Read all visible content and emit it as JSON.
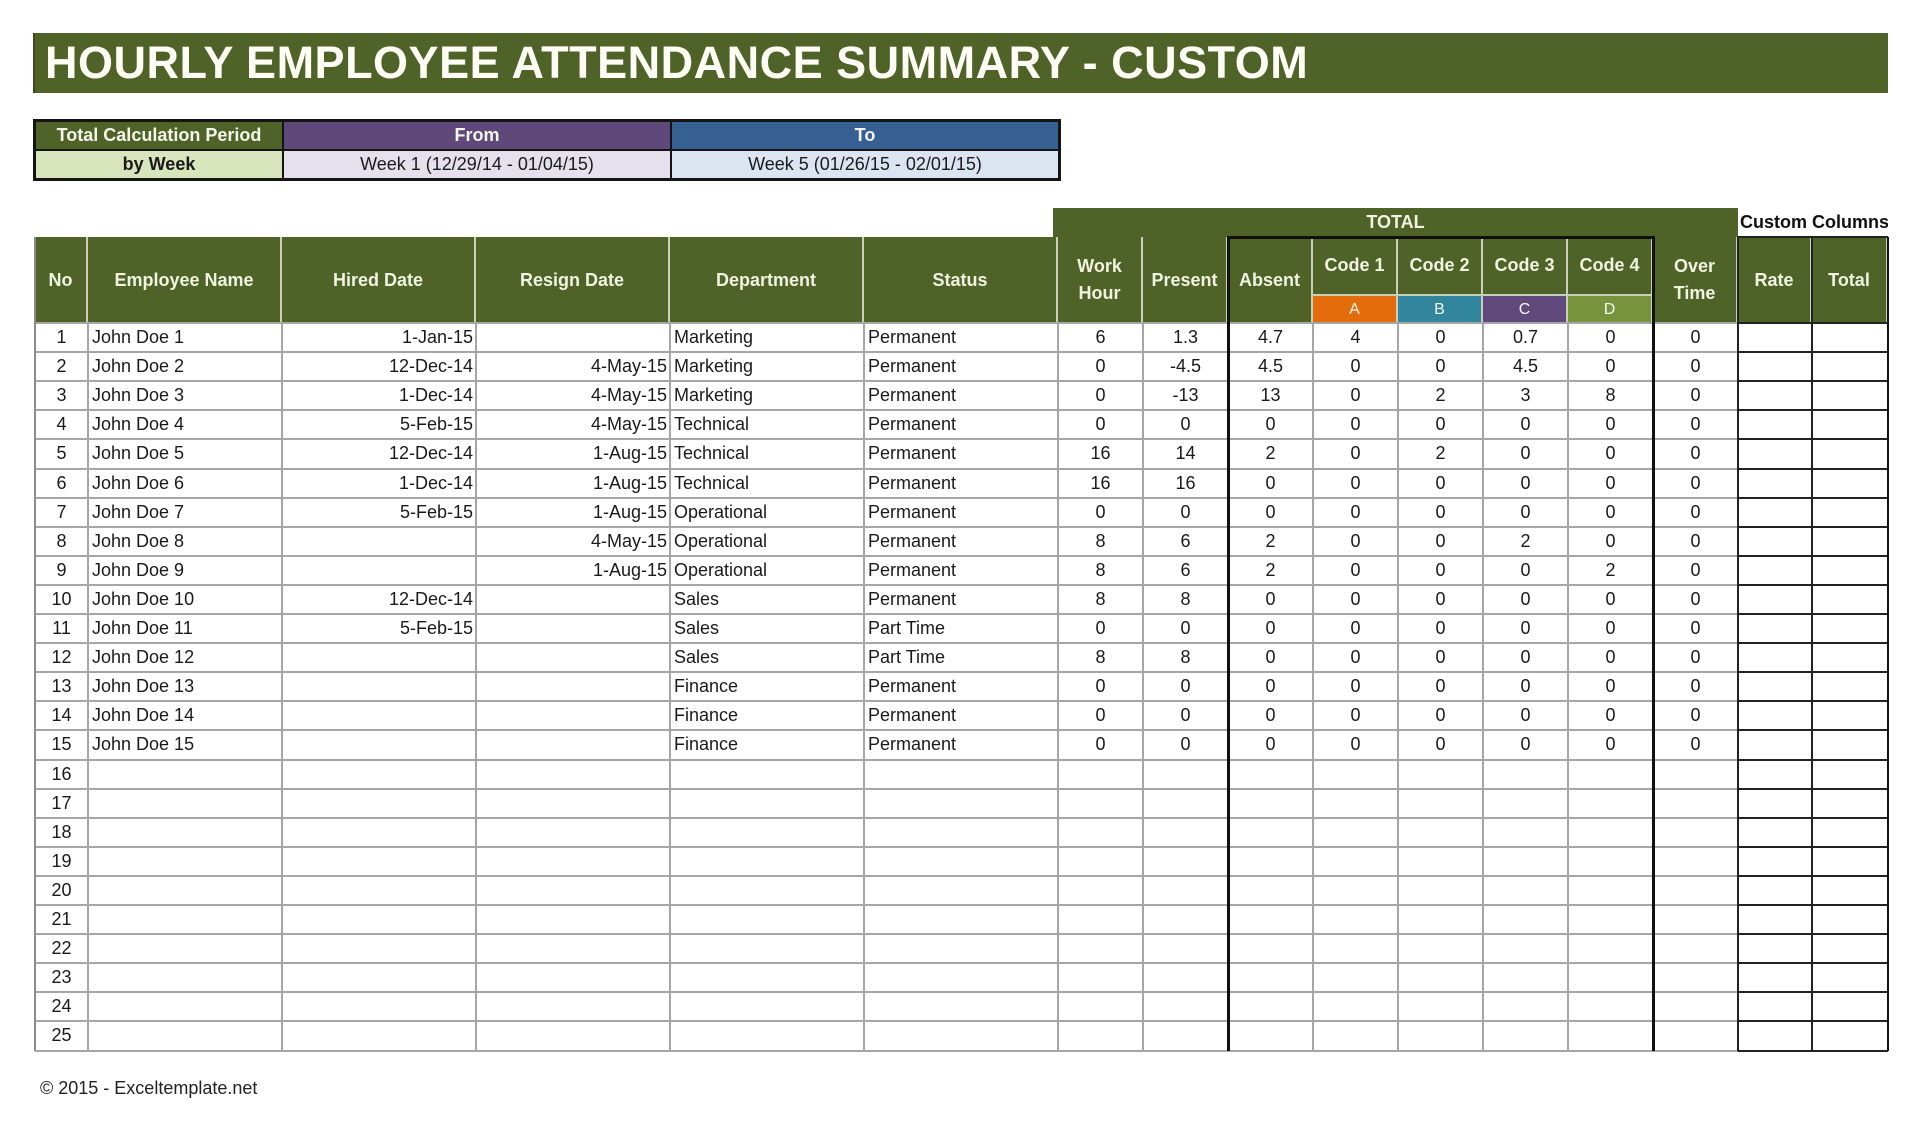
{
  "title": "HOURLY EMPLOYEE ATTENDANCE SUMMARY - CUSTOM",
  "period": {
    "label_header": "Total Calculation Period",
    "label_value": "by Week",
    "from_header": "From",
    "from_value": "Week 1 (12/29/14 - 01/04/15)",
    "to_header": "To",
    "to_value": "Week 5 (01/26/15 - 02/01/15)"
  },
  "colors": {
    "header_green": "#4F6228",
    "from_purple": "#5F497A",
    "to_blue": "#366092",
    "label_light_green": "#D7E4BC",
    "from_light": "#E5E0EC",
    "to_light": "#DBE5F1",
    "code_a": "#E46C0A",
    "code_b": "#31859C",
    "code_c": "#604A7B",
    "code_d": "#77933C"
  },
  "table": {
    "group_total_label": "TOTAL",
    "group_custom_label": "Custom Columns",
    "headers": {
      "no": "No",
      "employee_name": "Employee Name",
      "hired_date": "Hired Date",
      "resign_date": "Resign Date",
      "department": "Department",
      "status": "Status",
      "work_hour": "Work Hour",
      "present": "Present",
      "absent": "Absent",
      "code1": "Code 1",
      "code2": "Code 2",
      "code3": "Code 3",
      "code4": "Code 4",
      "over_time": "Over Time",
      "rate": "Rate",
      "total": "Total"
    },
    "code_letters": [
      "A",
      "B",
      "C",
      "D"
    ],
    "rows": [
      {
        "no": "1",
        "name": "John Doe 1",
        "hired": "1-Jan-15",
        "resign": "",
        "dept": "Marketing",
        "status": "Permanent",
        "work": "6",
        "present": "1.3",
        "absent": "4.7",
        "c1": "4",
        "c2": "0",
        "c3": "0.7",
        "c4": "0",
        "ot": "0",
        "rate": "",
        "total": ""
      },
      {
        "no": "2",
        "name": "John Doe 2",
        "hired": "12-Dec-14",
        "resign": "4-May-15",
        "dept": "Marketing",
        "status": "Permanent",
        "work": "0",
        "present": "-4.5",
        "absent": "4.5",
        "c1": "0",
        "c2": "0",
        "c3": "4.5",
        "c4": "0",
        "ot": "0",
        "rate": "",
        "total": ""
      },
      {
        "no": "3",
        "name": "John Doe 3",
        "hired": "1-Dec-14",
        "resign": "4-May-15",
        "dept": "Marketing",
        "status": "Permanent",
        "work": "0",
        "present": "-13",
        "absent": "13",
        "c1": "0",
        "c2": "2",
        "c3": "3",
        "c4": "8",
        "ot": "0",
        "rate": "",
        "total": ""
      },
      {
        "no": "4",
        "name": "John Doe 4",
        "hired": "5-Feb-15",
        "resign": "4-May-15",
        "dept": "Technical",
        "status": "Permanent",
        "work": "0",
        "present": "0",
        "absent": "0",
        "c1": "0",
        "c2": "0",
        "c3": "0",
        "c4": "0",
        "ot": "0",
        "rate": "",
        "total": ""
      },
      {
        "no": "5",
        "name": "John Doe 5",
        "hired": "12-Dec-14",
        "resign": "1-Aug-15",
        "dept": "Technical",
        "status": "Permanent",
        "work": "16",
        "present": "14",
        "absent": "2",
        "c1": "0",
        "c2": "2",
        "c3": "0",
        "c4": "0",
        "ot": "0",
        "rate": "",
        "total": ""
      },
      {
        "no": "6",
        "name": "John Doe 6",
        "hired": "1-Dec-14",
        "resign": "1-Aug-15",
        "dept": "Technical",
        "status": "Permanent",
        "work": "16",
        "present": "16",
        "absent": "0",
        "c1": "0",
        "c2": "0",
        "c3": "0",
        "c4": "0",
        "ot": "0",
        "rate": "",
        "total": ""
      },
      {
        "no": "7",
        "name": "John Doe 7",
        "hired": "5-Feb-15",
        "resign": "1-Aug-15",
        "dept": "Operational",
        "status": "Permanent",
        "work": "0",
        "present": "0",
        "absent": "0",
        "c1": "0",
        "c2": "0",
        "c3": "0",
        "c4": "0",
        "ot": "0",
        "rate": "",
        "total": ""
      },
      {
        "no": "8",
        "name": "John Doe 8",
        "hired": "",
        "resign": "4-May-15",
        "dept": "Operational",
        "status": "Permanent",
        "work": "8",
        "present": "6",
        "absent": "2",
        "c1": "0",
        "c2": "0",
        "c3": "2",
        "c4": "0",
        "ot": "0",
        "rate": "",
        "total": ""
      },
      {
        "no": "9",
        "name": "John Doe 9",
        "hired": "",
        "resign": "1-Aug-15",
        "dept": "Operational",
        "status": "Permanent",
        "work": "8",
        "present": "6",
        "absent": "2",
        "c1": "0",
        "c2": "0",
        "c3": "0",
        "c4": "2",
        "ot": "0",
        "rate": "",
        "total": ""
      },
      {
        "no": "10",
        "name": "John Doe 10",
        "hired": "12-Dec-14",
        "resign": "",
        "dept": "Sales",
        "status": "Permanent",
        "work": "8",
        "present": "8",
        "absent": "0",
        "c1": "0",
        "c2": "0",
        "c3": "0",
        "c4": "0",
        "ot": "0",
        "rate": "",
        "total": ""
      },
      {
        "no": "11",
        "name": "John Doe 11",
        "hired": "5-Feb-15",
        "resign": "",
        "dept": "Sales",
        "status": "Part Time",
        "work": "0",
        "present": "0",
        "absent": "0",
        "c1": "0",
        "c2": "0",
        "c3": "0",
        "c4": "0",
        "ot": "0",
        "rate": "",
        "total": ""
      },
      {
        "no": "12",
        "name": "John Doe 12",
        "hired": "",
        "resign": "",
        "dept": "Sales",
        "status": "Part Time",
        "work": "8",
        "present": "8",
        "absent": "0",
        "c1": "0",
        "c2": "0",
        "c3": "0",
        "c4": "0",
        "ot": "0",
        "rate": "",
        "total": ""
      },
      {
        "no": "13",
        "name": "John Doe 13",
        "hired": "",
        "resign": "",
        "dept": "Finance",
        "status": "Permanent",
        "work": "0",
        "present": "0",
        "absent": "0",
        "c1": "0",
        "c2": "0",
        "c3": "0",
        "c4": "0",
        "ot": "0",
        "rate": "",
        "total": ""
      },
      {
        "no": "14",
        "name": "John Doe 14",
        "hired": "",
        "resign": "",
        "dept": "Finance",
        "status": "Permanent",
        "work": "0",
        "present": "0",
        "absent": "0",
        "c1": "0",
        "c2": "0",
        "c3": "0",
        "c4": "0",
        "ot": "0",
        "rate": "",
        "total": ""
      },
      {
        "no": "15",
        "name": "John Doe 15",
        "hired": "",
        "resign": "",
        "dept": "Finance",
        "status": "Permanent",
        "work": "0",
        "present": "0",
        "absent": "0",
        "c1": "0",
        "c2": "0",
        "c3": "0",
        "c4": "0",
        "ot": "0",
        "rate": "",
        "total": ""
      },
      {
        "no": "16",
        "name": "",
        "hired": "",
        "resign": "",
        "dept": "",
        "status": "",
        "work": "",
        "present": "",
        "absent": "",
        "c1": "",
        "c2": "",
        "c3": "",
        "c4": "",
        "ot": "",
        "rate": "",
        "total": ""
      },
      {
        "no": "17",
        "name": "",
        "hired": "",
        "resign": "",
        "dept": "",
        "status": "",
        "work": "",
        "present": "",
        "absent": "",
        "c1": "",
        "c2": "",
        "c3": "",
        "c4": "",
        "ot": "",
        "rate": "",
        "total": ""
      },
      {
        "no": "18",
        "name": "",
        "hired": "",
        "resign": "",
        "dept": "",
        "status": "",
        "work": "",
        "present": "",
        "absent": "",
        "c1": "",
        "c2": "",
        "c3": "",
        "c4": "",
        "ot": "",
        "rate": "",
        "total": ""
      },
      {
        "no": "19",
        "name": "",
        "hired": "",
        "resign": "",
        "dept": "",
        "status": "",
        "work": "",
        "present": "",
        "absent": "",
        "c1": "",
        "c2": "",
        "c3": "",
        "c4": "",
        "ot": "",
        "rate": "",
        "total": ""
      },
      {
        "no": "20",
        "name": "",
        "hired": "",
        "resign": "",
        "dept": "",
        "status": "",
        "work": "",
        "present": "",
        "absent": "",
        "c1": "",
        "c2": "",
        "c3": "",
        "c4": "",
        "ot": "",
        "rate": "",
        "total": ""
      },
      {
        "no": "21",
        "name": "",
        "hired": "",
        "resign": "",
        "dept": "",
        "status": "",
        "work": "",
        "present": "",
        "absent": "",
        "c1": "",
        "c2": "",
        "c3": "",
        "c4": "",
        "ot": "",
        "rate": "",
        "total": ""
      },
      {
        "no": "22",
        "name": "",
        "hired": "",
        "resign": "",
        "dept": "",
        "status": "",
        "work": "",
        "present": "",
        "absent": "",
        "c1": "",
        "c2": "",
        "c3": "",
        "c4": "",
        "ot": "",
        "rate": "",
        "total": ""
      },
      {
        "no": "23",
        "name": "",
        "hired": "",
        "resign": "",
        "dept": "",
        "status": "",
        "work": "",
        "present": "",
        "absent": "",
        "c1": "",
        "c2": "",
        "c3": "",
        "c4": "",
        "ot": "",
        "rate": "",
        "total": ""
      },
      {
        "no": "24",
        "name": "",
        "hired": "",
        "resign": "",
        "dept": "",
        "status": "",
        "work": "",
        "present": "",
        "absent": "",
        "c1": "",
        "c2": "",
        "c3": "",
        "c4": "",
        "ot": "",
        "rate": "",
        "total": ""
      },
      {
        "no": "25",
        "name": "",
        "hired": "",
        "resign": "",
        "dept": "",
        "status": "",
        "work": "",
        "present": "",
        "absent": "",
        "c1": "",
        "c2": "",
        "c3": "",
        "c4": "",
        "ot": "",
        "rate": "",
        "total": ""
      }
    ]
  },
  "footer": "© 2015 - Exceltemplate.net"
}
